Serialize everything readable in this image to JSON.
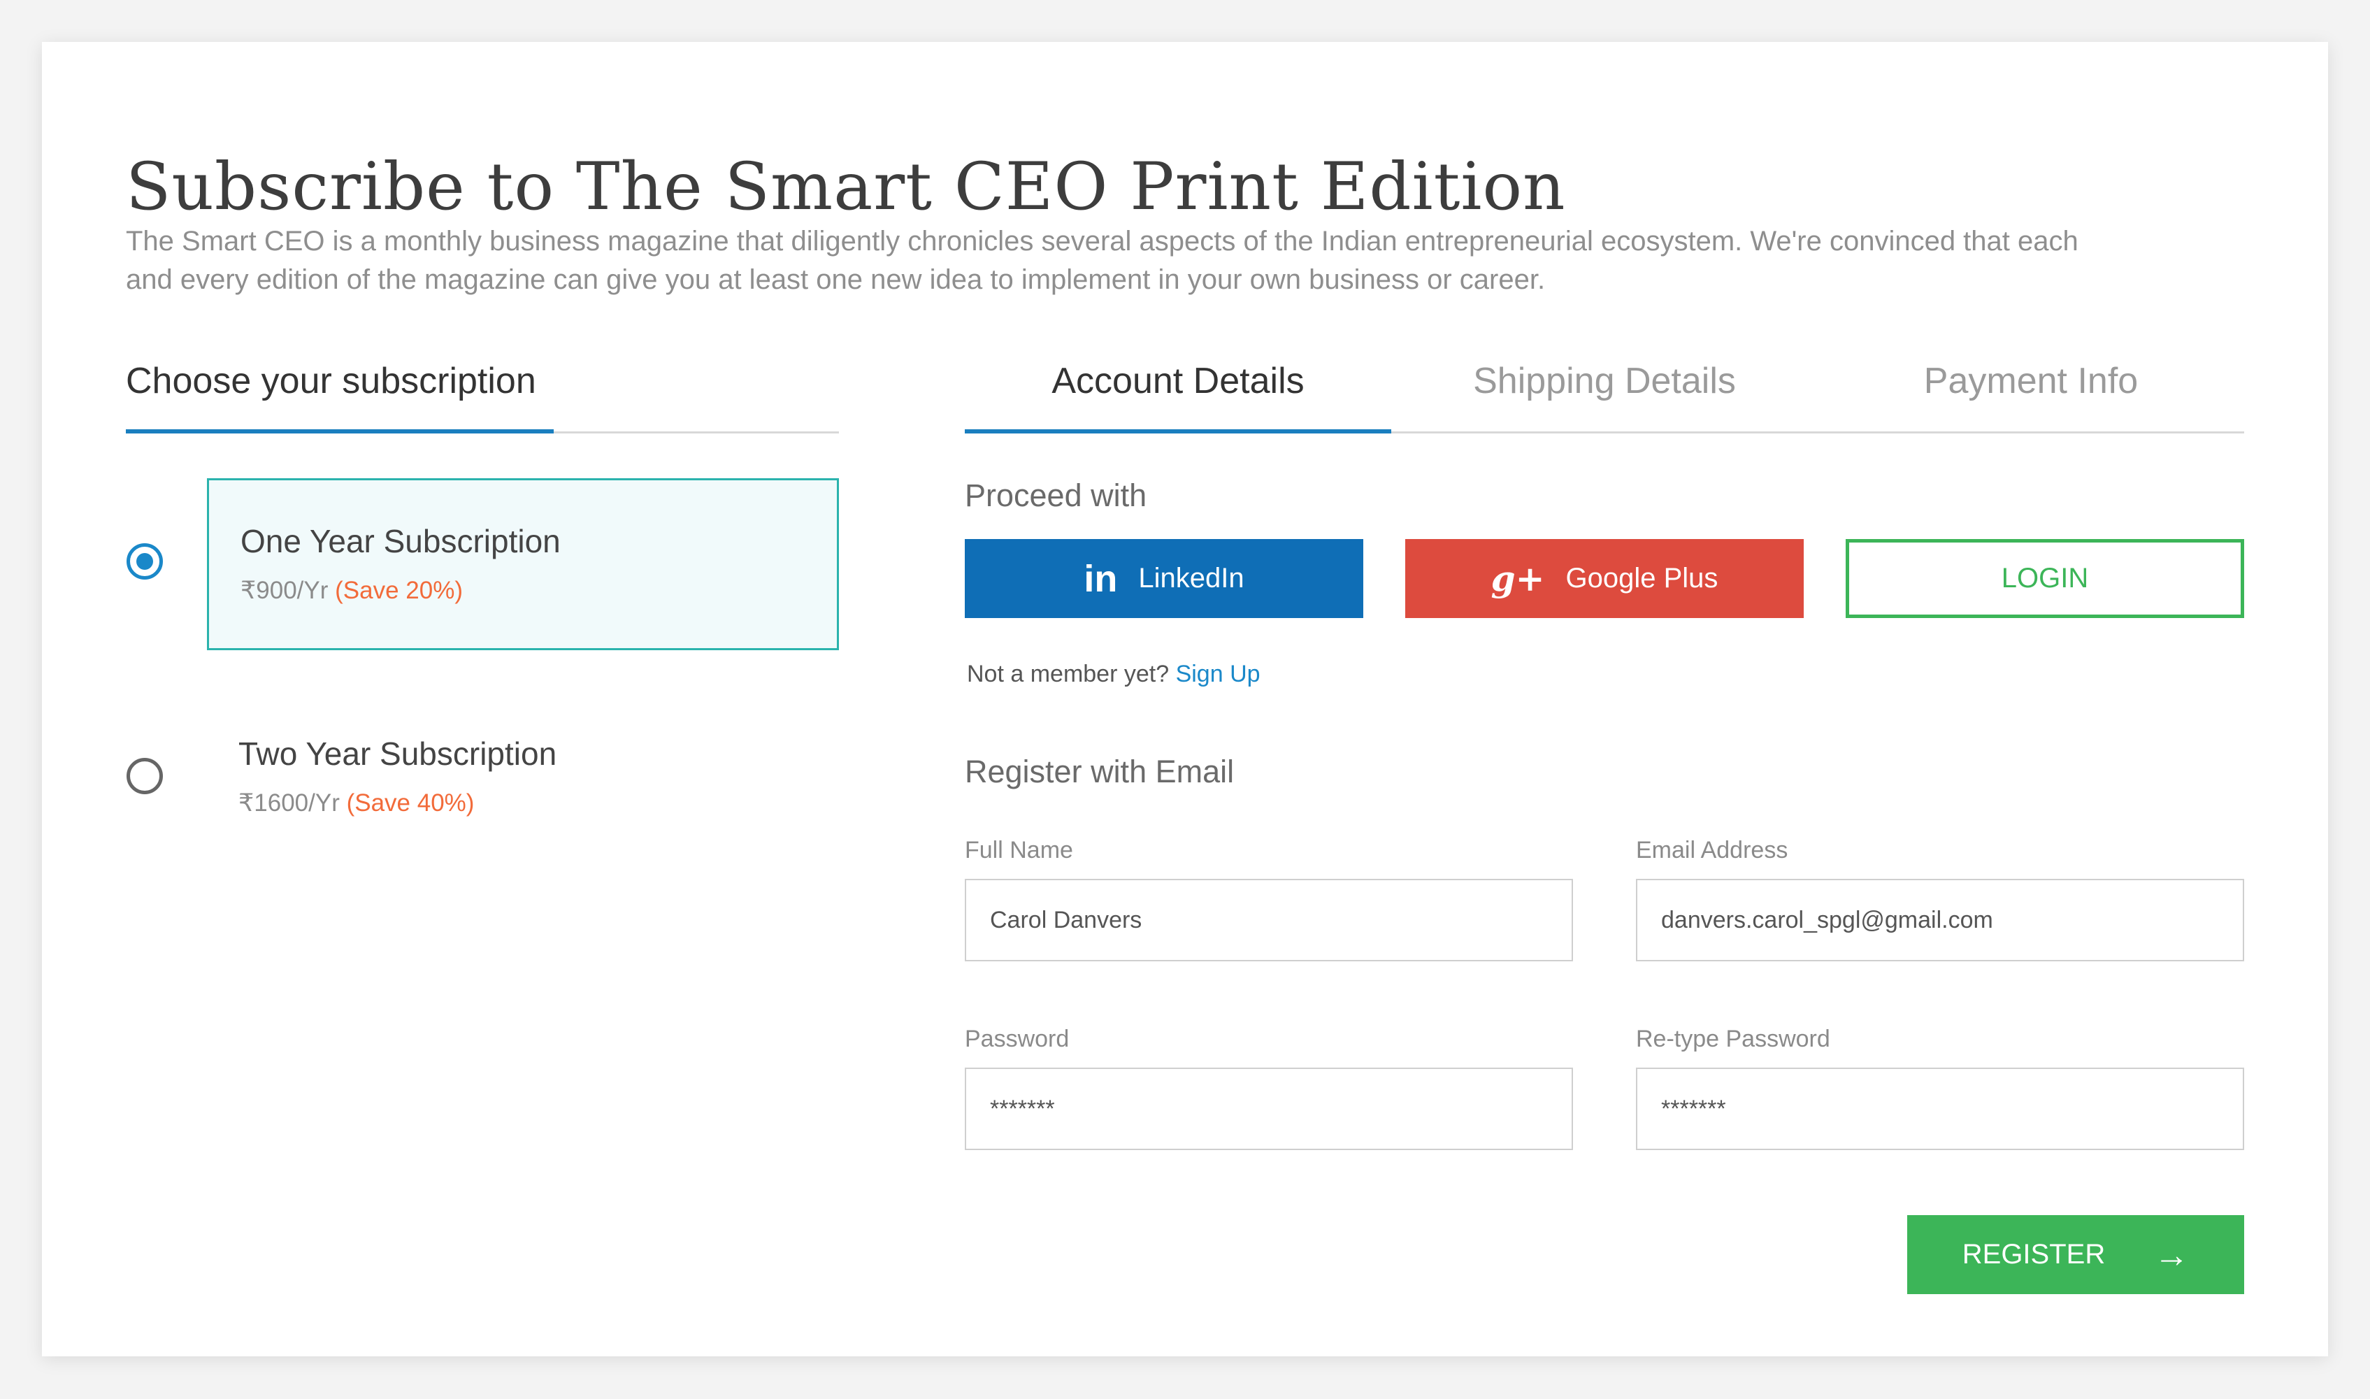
{
  "page": {
    "title": "Subscribe to The Smart CEO Print Edition",
    "intro": "The Smart CEO is a monthly business magazine that diligently chronicles several aspects of the Indian entrepreneurial ecosystem. We're convinced that each and every edition of the magazine can give you at least one new idea to implement in your own business or career."
  },
  "subscription": {
    "heading": "Choose your subscription",
    "plans": [
      {
        "name": "One Year Subscription",
        "price": "₹900/Yr",
        "save": "(Save 20%)",
        "selected": true
      },
      {
        "name": "Two Year Subscription",
        "price": "₹1600/Yr",
        "save": "(Save 40%)",
        "selected": false
      }
    ]
  },
  "tabs": [
    {
      "label": "Account Details",
      "active": true
    },
    {
      "label": "Shipping Details",
      "active": false
    },
    {
      "label": "Payment Info",
      "active": false
    }
  ],
  "proceed": {
    "label": "Proceed with",
    "linkedin": {
      "icon": "linkedin-icon",
      "glyph": "in",
      "label": "LinkedIn",
      "color": "#0f6eb6"
    },
    "google": {
      "icon": "google-plus-icon",
      "glyph": "g+",
      "label": "Google Plus",
      "color": "#dd4b3e"
    },
    "login": {
      "label": "LOGIN",
      "color": "#3cb558"
    }
  },
  "member": {
    "text": "Not a member yet?",
    "link": "Sign Up"
  },
  "register": {
    "heading": "Register with Email",
    "full_name": {
      "label": "Full Name",
      "value": "Carol Danvers"
    },
    "email": {
      "label": "Email Address",
      "value": "danvers.carol_spgl@gmail.com"
    },
    "password": {
      "label": "Password",
      "value": "*******"
    },
    "retype": {
      "label": "Re-type Password",
      "value": "*******"
    },
    "button": "REGISTER",
    "button_icon": "arrow-right-icon",
    "arrow": "→"
  },
  "colors": {
    "accent": "#1a7fbf",
    "selected_border": "#2bb3ad",
    "save": "#f26b3a",
    "green": "#3cb558"
  }
}
